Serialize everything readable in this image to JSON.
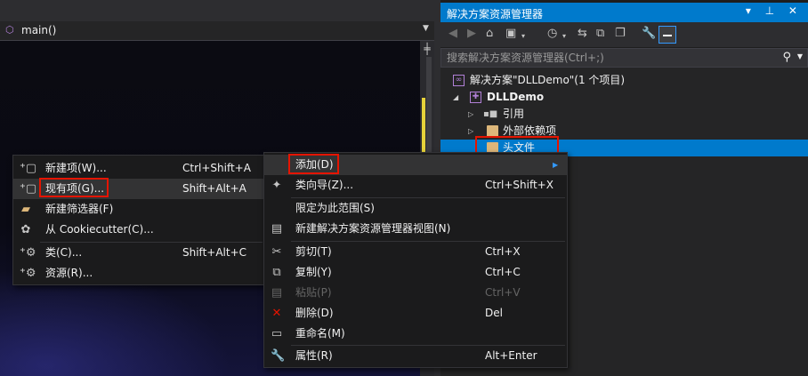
{
  "editor": {
    "function_name": "main()"
  },
  "solution_explorer": {
    "title": "解决方案资源管理器",
    "title_buttons": "▾ ⊥ ✕",
    "search_placeholder": "搜索解决方案资源管理器(Ctrl+;)",
    "tree": [
      {
        "label": "解决方案\"DLLDemo\"(1 个项目)",
        "icon": "solution-icon"
      },
      {
        "label": "DLLDemo",
        "icon": "project-icon",
        "expanded": true
      },
      {
        "label": "引用",
        "icon": "references-icon"
      },
      {
        "label": "外部依赖项",
        "icon": "folder-icon"
      },
      {
        "label": "头文件",
        "icon": "folder-icon",
        "selected": true
      }
    ]
  },
  "left_menu": {
    "items": [
      {
        "label": "新建项(W)...",
        "shortcut": "Ctrl+Shift+A",
        "icon": "new-item-icon"
      },
      {
        "label": "现有项(G)...",
        "shortcut": "Shift+Alt+A",
        "icon": "existing-item-icon",
        "highlighted": true
      },
      {
        "label": "新建筛选器(F)",
        "shortcut": "",
        "icon": "new-filter-icon"
      },
      {
        "label": "从 Cookiecutter(C)...",
        "shortcut": "",
        "icon": "cookiecutter-icon"
      },
      {
        "label": "类(C)...",
        "shortcut": "Shift+Alt+C",
        "icon": "class-icon"
      },
      {
        "label": "资源(R)...",
        "shortcut": "",
        "icon": "resource-icon"
      }
    ]
  },
  "context_menu": {
    "items": [
      {
        "label": "添加(D)",
        "shortcut": "",
        "icon": "",
        "submenu": true,
        "highlighted": true
      },
      {
        "label": "类向导(Z)...",
        "shortcut": "Ctrl+Shift+X",
        "icon": "class-wizard-icon"
      },
      {
        "label": "限定为此范围(S)",
        "shortcut": "",
        "icon": ""
      },
      {
        "label": "新建解决方案资源管理器视图(N)",
        "shortcut": "",
        "icon": "new-view-icon"
      },
      {
        "label": "剪切(T)",
        "shortcut": "Ctrl+X",
        "icon": "cut-icon"
      },
      {
        "label": "复制(Y)",
        "shortcut": "Ctrl+C",
        "icon": "copy-icon"
      },
      {
        "label": "粘贴(P)",
        "shortcut": "Ctrl+V",
        "icon": "paste-icon",
        "disabled": true
      },
      {
        "label": "删除(D)",
        "shortcut": "Del",
        "icon": "delete-icon"
      },
      {
        "label": "重命名(M)",
        "shortcut": "",
        "icon": "rename-icon"
      },
      {
        "label": "属性(R)",
        "shortcut": "Alt+Enter",
        "icon": "properties-icon"
      }
    ]
  },
  "colors": {
    "accent": "#007acc",
    "highlight_box": "#e51400"
  }
}
